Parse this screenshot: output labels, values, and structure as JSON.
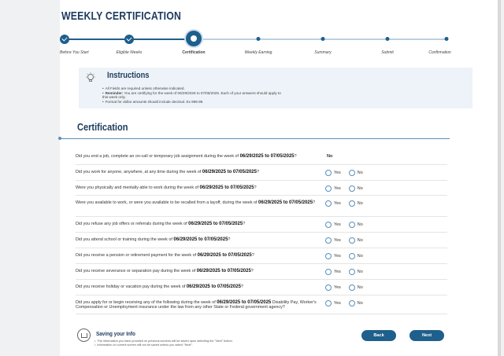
{
  "page_title": "WEEKLY CERTIFICATION",
  "steps": [
    {
      "label": "Before You Start",
      "state": "done"
    },
    {
      "label": "Eligible Weeks",
      "state": "done"
    },
    {
      "label": "Certification",
      "state": "current"
    },
    {
      "label": "Weekly Earning",
      "state": "future"
    },
    {
      "label": "Summary",
      "state": "future"
    },
    {
      "label": "Submit",
      "state": "future"
    },
    {
      "label": "Confirmation",
      "state": "future"
    }
  ],
  "colors": {
    "primary": "#1e5f8c",
    "heading": "#1e3a5f",
    "instructions_bg": "#edf3f8",
    "line": "#5b8fb9"
  },
  "instructions": {
    "title": "Instructions",
    "items": [
      {
        "strong": "",
        "text": "All Fields are required unless otherwise indicated."
      },
      {
        "strong": "Reminder:",
        "text": " You are certifying for the week of 06/29/2025 to 07/05/2025. Each of your answers should apply to this week only."
      },
      {
        "strong": "",
        "text": "Format for dollar amounts should include decimal. Ex 999.99."
      }
    ]
  },
  "section_title": "Certification",
  "questions": [
    {
      "pre": "Did you end a job, complete an on-call or temporary job assignment during the week of ",
      "dates": "06/29/2025 to 07/05/2025",
      "post": "?",
      "answer": "No"
    },
    {
      "pre": "Did you work for anyone, anywhere, at any time during the week of ",
      "dates": "06/29/2025 to 07/05/2025",
      "post": "?",
      "answer": null
    },
    {
      "pre": "Were you physically and mentally able to work during the week of ",
      "dates": "06/29/2025 to 07/05/2025",
      "post": "?",
      "answer": null
    },
    {
      "pre": "Were you available to work, or were you available to be recalled from a layoff, during the week of ",
      "dates": "06/29/2025 to 07/05/2025",
      "post": "?",
      "answer": null
    },
    {
      "pre": "Did you refuse any job offers or referrals during the week of ",
      "dates": "06/29/2025 to 07/05/2025",
      "post": "?",
      "answer": null
    },
    {
      "pre": "Did you attend school or training during the week of ",
      "dates": "06/29/2025 to 07/05/2025",
      "post": "?",
      "answer": null
    },
    {
      "pre": "Did you receive a pension or retirement payment for the week of ",
      "dates": "06/29/2025 to 07/05/2025",
      "post": "?",
      "answer": null
    },
    {
      "pre": "Did you receive severance or separation pay during the week of ",
      "dates": "06/29/2025 to 07/05/2025",
      "post": "?",
      "answer": null
    },
    {
      "pre": "Did you receive holiday or vacation pay during the week of ",
      "dates": "06/29/2025 to 07/05/2025",
      "post": "?",
      "answer": null
    },
    {
      "pre": "Did you apply for or begin receiving any of the following during the week of ",
      "dates": "06/29/2025 to 07/05/2025",
      "post": " Disability Pay, Worker's Compensation or Unemployment insurance under the law from any other State or Federal government agency?",
      "answer": null
    }
  ],
  "radio": {
    "yes_label": "Yes",
    "no_label": "No"
  },
  "saving": {
    "title": "Saving your Info",
    "items": [
      "The information you have provided on previous screens will be saved upon selecting the \"Next\" button.",
      "Information on current screen will not be saved unless you select \"Next\"."
    ]
  },
  "buttons": {
    "back": "Back",
    "next": "Next"
  }
}
